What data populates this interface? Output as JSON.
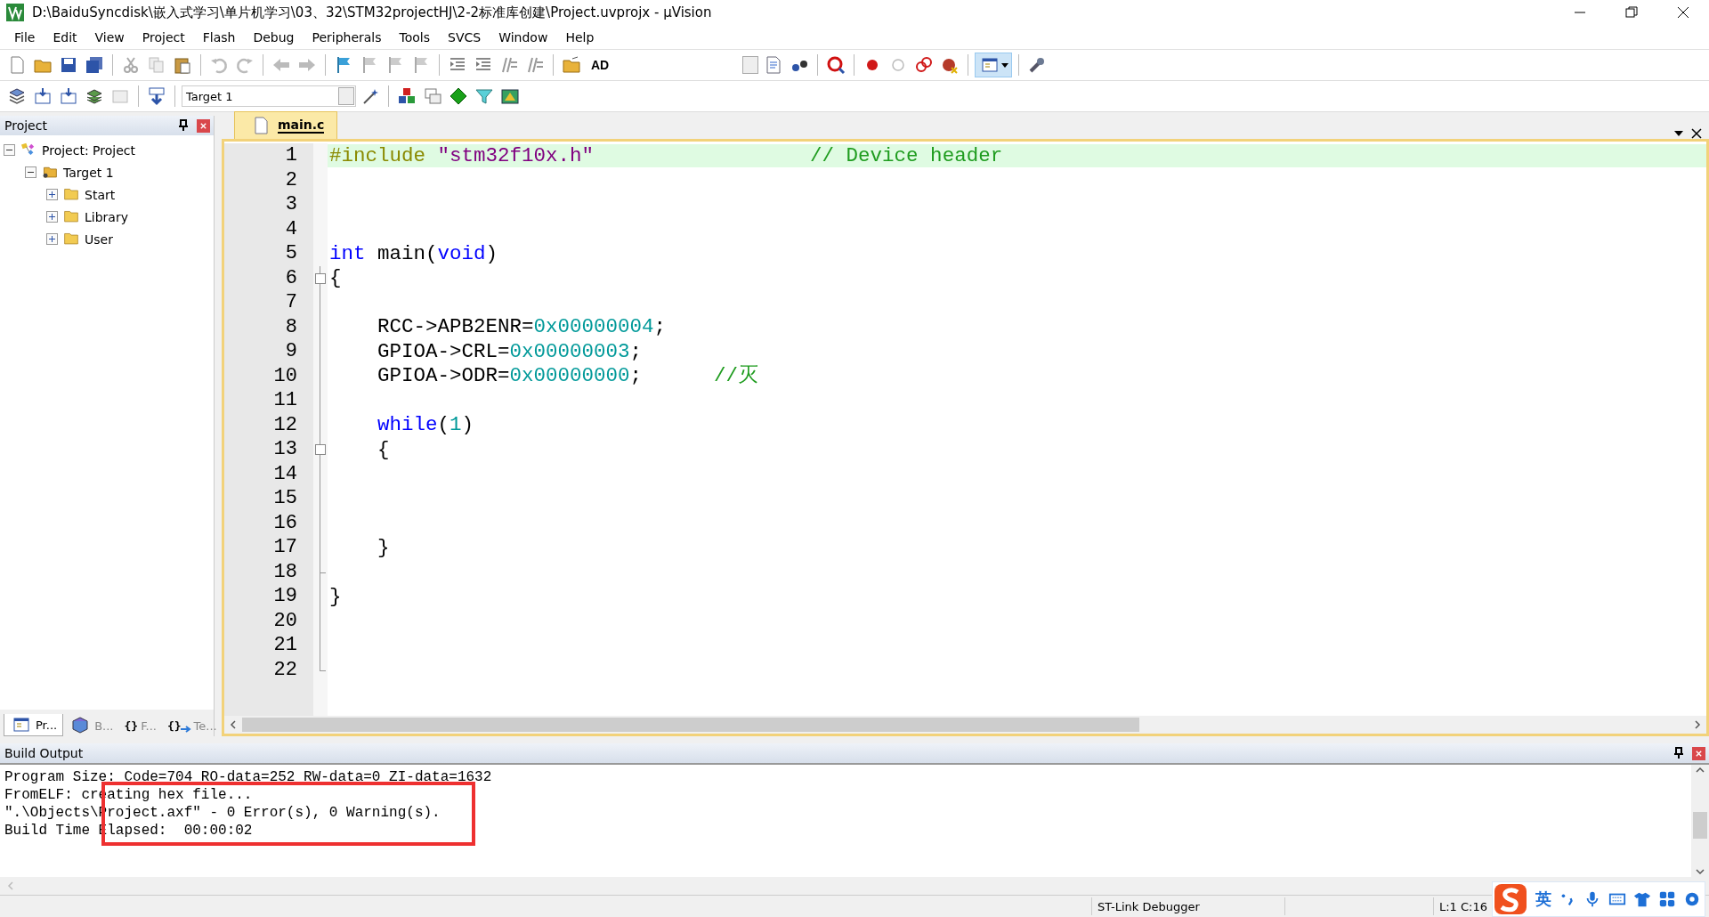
{
  "window": {
    "title": "D:\\BaiduSyncdisk\\嵌入式学习\\单片机学习\\03、32\\STM32projectHJ\\2-2标准库创建\\Project.uvprojx - µVision"
  },
  "menu": [
    "File",
    "Edit",
    "View",
    "Project",
    "Flash",
    "Debug",
    "Peripherals",
    "Tools",
    "SVCS",
    "Window",
    "Help"
  ],
  "toolbar": {
    "find_text": "AD",
    "target": "Target 1"
  },
  "project_panel": {
    "title": "Project",
    "tree": [
      {
        "label": "Project: Project",
        "kind": "project",
        "expanded": true,
        "children": [
          {
            "label": "Target 1",
            "kind": "target",
            "expanded": true,
            "children": [
              {
                "label": "Start",
                "kind": "group",
                "expanded": false
              },
              {
                "label": "Library",
                "kind": "group",
                "expanded": false
              },
              {
                "label": "User",
                "kind": "group",
                "expanded": false
              }
            ]
          }
        ]
      }
    ],
    "tabs": [
      {
        "label": "Pr...",
        "kind": "project",
        "selected": true
      },
      {
        "label": "B...",
        "kind": "books",
        "selected": false
      },
      {
        "glyph": "{}",
        "label": "F...",
        "kind": "functions",
        "selected": false
      },
      {
        "glyph": "{}",
        "label": "Te...",
        "kind": "templates",
        "selected": false
      }
    ]
  },
  "editor": {
    "tabs": [
      {
        "label": "main.c",
        "selected": true
      }
    ],
    "lines": [
      {
        "number": "1",
        "current": true,
        "fold_start": false,
        "fold_end": false,
        "tokens": [
          {
            "kind": "preproc",
            "text": "#include "
          },
          {
            "kind": "string",
            "text": "\"stm32f10x.h\""
          },
          {
            "kind": "comment",
            "text": "                  // Device header"
          }
        ]
      },
      {
        "number": "2",
        "current": false,
        "fold_start": false,
        "fold_end": false
      },
      {
        "number": "3",
        "current": false,
        "fold_start": false,
        "fold_end": false
      },
      {
        "number": "4",
        "current": false,
        "fold_start": false,
        "fold_end": false
      },
      {
        "number": "5",
        "current": false,
        "fold_start": false,
        "fold_end": false,
        "tokens": [
          {
            "kind": "keyword",
            "text": "int"
          },
          {
            "kind": "plain",
            "text": " main("
          },
          {
            "kind": "keyword",
            "text": "void"
          },
          {
            "kind": "plain",
            "text": ")"
          }
        ]
      },
      {
        "number": "6",
        "current": false,
        "fold_start": true,
        "fold_end": false,
        "tokens": [
          {
            "kind": "plain",
            "text": "{"
          }
        ]
      },
      {
        "number": "7",
        "current": false,
        "fold_start": false,
        "fold_end": false
      },
      {
        "number": "8",
        "current": false,
        "fold_start": false,
        "fold_end": false,
        "tokens": [
          {
            "kind": "plain",
            "text": "    RCC->APB2ENR="
          },
          {
            "kind": "number",
            "text": "0x00000004"
          },
          {
            "kind": "plain",
            "text": ";"
          }
        ]
      },
      {
        "number": "9",
        "current": false,
        "fold_start": false,
        "fold_end": false,
        "tokens": [
          {
            "kind": "plain",
            "text": "    GPIOA->CRL="
          },
          {
            "kind": "number",
            "text": "0x00000003"
          },
          {
            "kind": "plain",
            "text": ";"
          }
        ]
      },
      {
        "number": "10",
        "current": false,
        "fold_start": false,
        "fold_end": false,
        "tokens": [
          {
            "kind": "plain",
            "text": "    GPIOA->ODR="
          },
          {
            "kind": "number",
            "text": "0x00000000"
          },
          {
            "kind": "plain",
            "text": ";      "
          },
          {
            "kind": "comment",
            "text": "//灭"
          }
        ]
      },
      {
        "number": "11",
        "current": false,
        "fold_start": false,
        "fold_end": false
      },
      {
        "number": "12",
        "current": false,
        "fold_start": false,
        "fold_end": false,
        "tokens": [
          {
            "kind": "keyword",
            "text": "    while"
          },
          {
            "kind": "plain",
            "text": "("
          },
          {
            "kind": "number",
            "text": "1"
          },
          {
            "kind": "plain",
            "text": ")"
          }
        ]
      },
      {
        "number": "13",
        "current": false,
        "fold_start": true,
        "fold_end": false,
        "tokens": [
          {
            "kind": "plain",
            "text": "    {"
          }
        ]
      },
      {
        "number": "14",
        "current": false,
        "fold_start": false,
        "fold_end": false
      },
      {
        "number": "15",
        "current": false,
        "fold_start": false,
        "fold_end": false
      },
      {
        "number": "16",
        "current": false,
        "fold_start": false,
        "fold_end": false
      },
      {
        "number": "17",
        "current": false,
        "fold_start": false,
        "fold_end": false,
        "tokens": [
          {
            "kind": "plain",
            "text": "    }"
          }
        ]
      },
      {
        "number": "18",
        "current": false,
        "fold_start": false,
        "fold_end": true
      },
      {
        "number": "19",
        "current": false,
        "fold_start": false,
        "fold_end": false,
        "tokens": [
          {
            "kind": "plain",
            "text": "}"
          }
        ]
      },
      {
        "number": "20",
        "current": false,
        "fold_start": false,
        "fold_end": false
      },
      {
        "number": "21",
        "current": false,
        "fold_start": false,
        "fold_end": false
      },
      {
        "number": "22",
        "current": false,
        "fold_start": false,
        "fold_end": true
      }
    ]
  },
  "build_output": {
    "title": "Build Output",
    "annotation_box": true,
    "lines": [
      "Program Size: Code=704 RO-data=252 RW-data=0 ZI-data=1632",
      "FromELF: creating hex file...",
      "\".\\Objects\\Project.axf\" - 0 Error(s), 0 Warning(s).",
      "Build Time Elapsed:  00:00:02"
    ]
  },
  "status_bar": {
    "debugger": "ST-Link Debugger",
    "position": "L:1 C:16"
  },
  "ime_bar": {
    "mode": "英"
  }
}
